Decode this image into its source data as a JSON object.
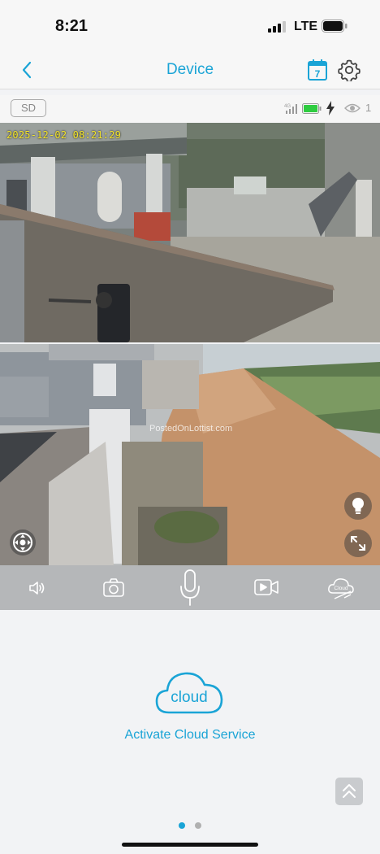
{
  "status_bar": {
    "time": "8:21",
    "carrier": "LTE"
  },
  "header": {
    "title": "Device",
    "calendar_day": "7",
    "icons": [
      "chevron-left-icon",
      "calendar-icon",
      "gear-icon"
    ]
  },
  "info_strip": {
    "storage_badge": "SD",
    "network_label": "4G",
    "viewer_count": "1",
    "battery_color": "#2ecc40"
  },
  "camera_feeds": [
    {
      "timestamp": "2025-12-02 08:21:29"
    },
    {
      "watermark": "PostedOnLottist.com"
    }
  ],
  "controls": {
    "items": [
      "speaker-icon",
      "snapshot-icon",
      "microphone-icon",
      "record-icon",
      "cloud-off-icon"
    ],
    "cloud_off_label": "Cloud"
  },
  "cloud_service": {
    "logo_text": "cloud",
    "link_text": "Activate Cloud Service"
  },
  "pager": {
    "count": 2,
    "active": 1
  },
  "colors": {
    "accent": "#1aa4d6",
    "control_bar": "#b5b7b9",
    "timestamp": "#f4e52a"
  }
}
